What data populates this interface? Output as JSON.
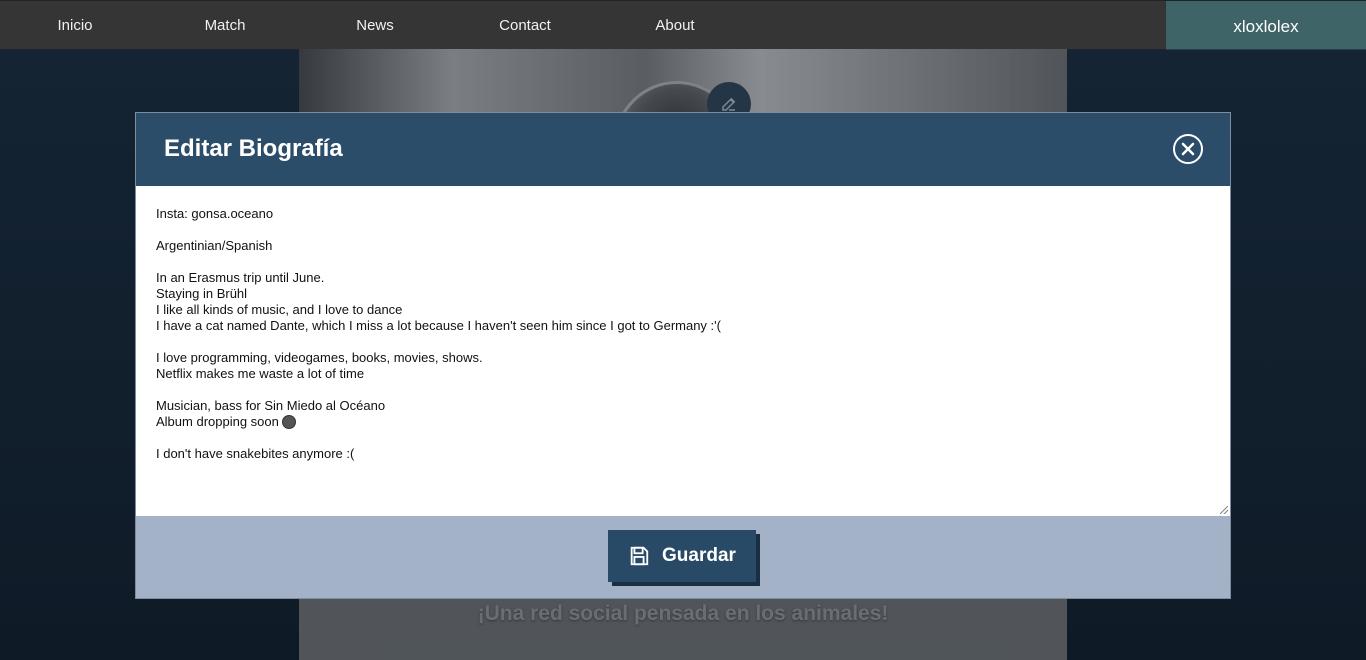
{
  "nav": {
    "items": [
      {
        "label": "Inicio"
      },
      {
        "label": "Match"
      },
      {
        "label": "News"
      },
      {
        "label": "Contact"
      },
      {
        "label": "About"
      }
    ],
    "username": "xloxlolex"
  },
  "background": {
    "tagline": "¡Una red social pensada en los animales!"
  },
  "modal": {
    "title": "Editar Biografía",
    "save_label": "Guardar",
    "bio_lines": [
      "Insta: gonsa.oceano",
      "",
      "Argentinian/Spanish",
      "",
      "In an Erasmus trip until June.",
      "Staying in Brühl",
      "I like all kinds of music, and I love to dance",
      "I have a cat named Dante, which I miss a lot because I haven't seen him since I got to Germany :'(",
      "",
      "I love programming, videogames, books, movies, shows.",
      "Netflix makes me waste a lot of time",
      "",
      "Musician, bass for Sin Miedo al Océano",
      "Album dropping soon",
      "",
      "I don't have snakebites anymore :("
    ]
  },
  "icons": {
    "close": "close-circle-icon",
    "save": "floppy-disk-icon",
    "edit": "pencil-icon",
    "emoji": "smiley-emoji-icon"
  },
  "colors": {
    "nav_bg": "#353535",
    "user_bg": "#3e6468",
    "modal_header": "#2c4d69",
    "modal_footer": "#a3b2c6",
    "button": "#284a66"
  }
}
